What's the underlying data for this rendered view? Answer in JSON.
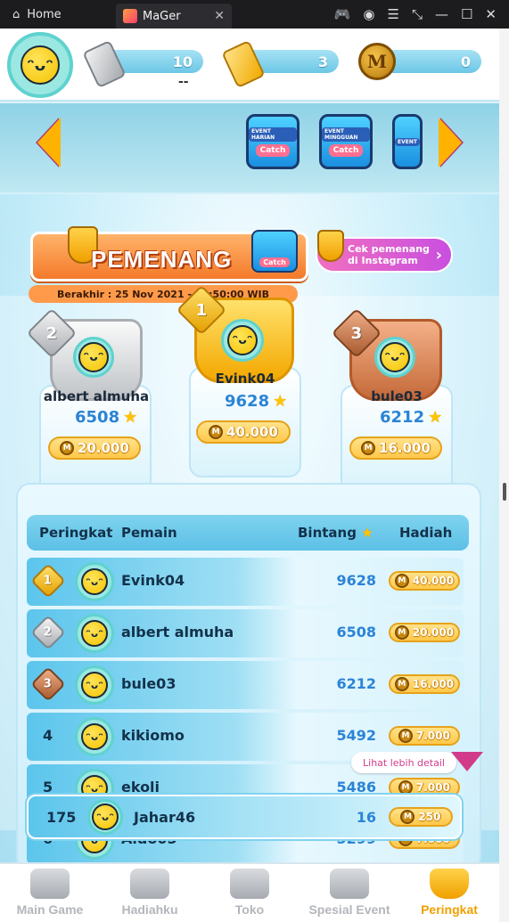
{
  "window": {
    "home_tab": "Home",
    "app_tab": "MaGer"
  },
  "header": {
    "silver_tickets": "10",
    "silver_sub": "--",
    "gold_tickets": "3",
    "coins": "0"
  },
  "events": {
    "cards": [
      {
        "label": "EVENT HARIAN",
        "badge": "Catch"
      },
      {
        "label": "EVENT MINGGUAN",
        "badge": "Catch"
      },
      {
        "label": "EVENT",
        "badge": ""
      }
    ]
  },
  "banner": {
    "title": "PEMENANG",
    "event_badge": "Catch",
    "instagram_line1": "Cek pemenang",
    "instagram_line2": "di Instagram",
    "deadline": "Berakhir : 25 Nov 2021 - 19:50:00 WIB"
  },
  "podium": {
    "first": {
      "rank": "1",
      "name": "Evink04",
      "stars": "9628",
      "prize": "40.000"
    },
    "second": {
      "rank": "2",
      "name": "albert almuha",
      "stars": "6508",
      "prize": "20.000"
    },
    "third": {
      "rank": "3",
      "name": "bule03",
      "stars": "6212",
      "prize": "16.000"
    }
  },
  "table": {
    "headers": {
      "rank": "Peringkat",
      "player": "Pemain",
      "stars": "Bintang",
      "prize": "Hadiah"
    },
    "rows": [
      {
        "rank": "1",
        "name": "Evink04",
        "stars": "9628",
        "prize": "40.000"
      },
      {
        "rank": "2",
        "name": "albert almuha",
        "stars": "6508",
        "prize": "20.000"
      },
      {
        "rank": "3",
        "name": "bule03",
        "stars": "6212",
        "prize": "16.000"
      },
      {
        "rank": "4",
        "name": "kikiomo",
        "stars": "5492",
        "prize": "7.000"
      },
      {
        "rank": "5",
        "name": "ekoli",
        "stars": "5486",
        "prize": "7.000"
      },
      {
        "rank": "6",
        "name": "Aldo05",
        "stars": "5299",
        "prize": "7.000"
      }
    ],
    "more_label": "Lihat lebih detail",
    "me": {
      "rank": "175",
      "name": "Jahar46",
      "stars": "16",
      "prize": "250"
    }
  },
  "nav": {
    "items": [
      {
        "label": "Main Game",
        "icon": "gamepad-icon"
      },
      {
        "label": "Hadiahku",
        "icon": "gift-ticket-icon"
      },
      {
        "label": "Toko",
        "icon": "shop-icon"
      },
      {
        "label": "Spesial Event",
        "icon": "special-event-icon"
      },
      {
        "label": "Peringkat",
        "icon": "trophy-icon"
      }
    ]
  },
  "colors": {
    "accent_blue": "#5cc0e6",
    "gold": "#f0a000",
    "star_text": "#2b84d6",
    "banner_orange": "#f47a2a"
  }
}
